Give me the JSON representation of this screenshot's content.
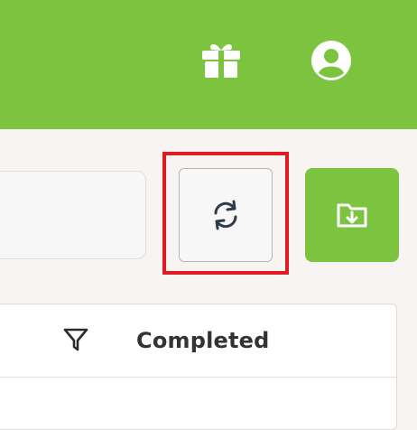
{
  "header": {
    "icons": [
      "gift-icon",
      "user-avatar-icon"
    ]
  },
  "toolbar": {
    "refresh_icon": "refresh-icon",
    "export_icon": "folder-download-icon"
  },
  "table": {
    "filter_icon": "filter-icon",
    "columns": [
      "Completed"
    ]
  },
  "colors": {
    "brand_green": "#7cc440",
    "highlight_red": "#e01b24",
    "background": "#f7f4f1"
  }
}
